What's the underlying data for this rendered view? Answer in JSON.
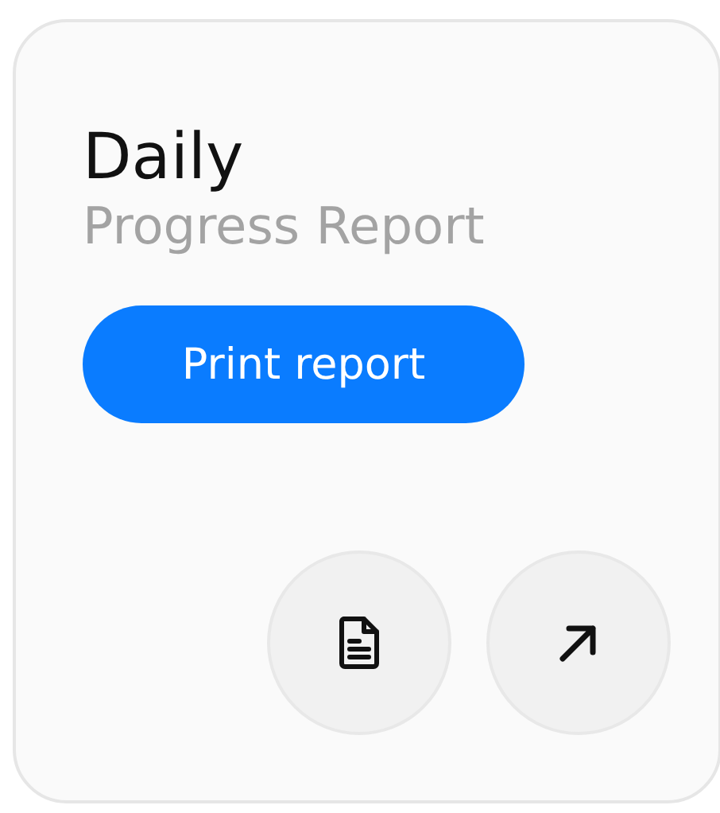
{
  "card": {
    "title": "Daily",
    "subtitle": "Progress Report",
    "button": "Print report"
  }
}
